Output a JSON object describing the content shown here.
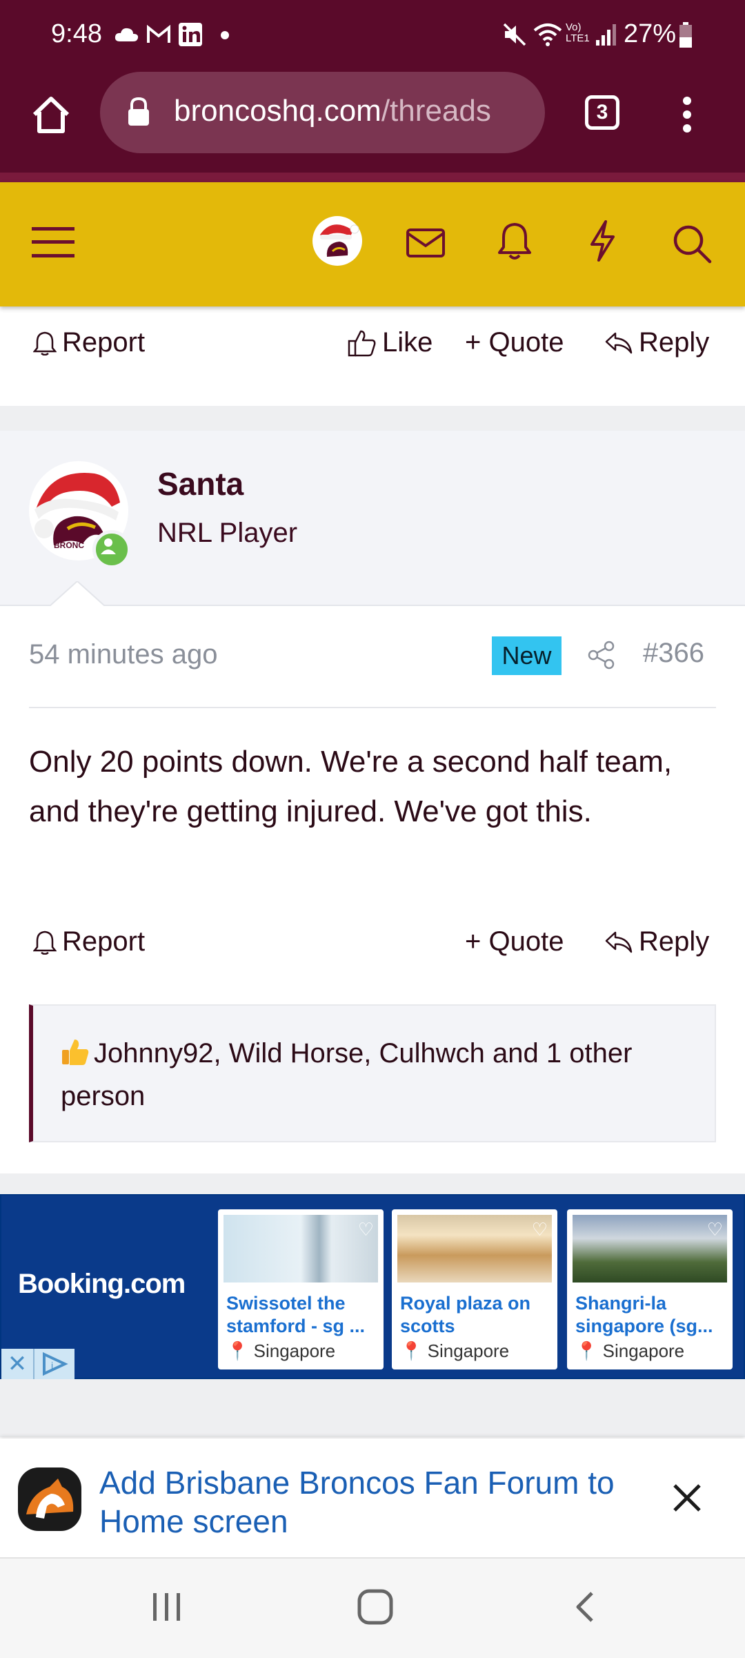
{
  "status_bar": {
    "time": "9:48",
    "icons": [
      "cloud-icon",
      "gmail-icon",
      "linkedin-icon",
      "dot-icon",
      "mute-icon",
      "wifi-icon",
      "volte-icon",
      "signal-icon",
      "battery-icon"
    ],
    "volte": "Vo) LTE1",
    "battery": "27%"
  },
  "browser": {
    "url_domain": "broncoshq.com",
    "url_path": "/threads",
    "tab_count": "3"
  },
  "top_actions": {
    "report": "Report",
    "like": "Like",
    "quote": "+ Quote",
    "reply": "Reply"
  },
  "post": {
    "author": "Santa",
    "role": "NRL Player",
    "time": "54 minutes ago",
    "badge": "New",
    "number": "#366",
    "body": "Only 20 points down. We're a second half team, and they're getting injured. We've got this.",
    "actions": {
      "report": "Report",
      "quote": "+ Quote",
      "reply": "Reply"
    },
    "reactions_text": "Johnny92, Wild Horse, Culhwch and 1 other person"
  },
  "ad": {
    "brand": "Booking.com",
    "cards": [
      {
        "title": "Swissotel the stamford - sg ...",
        "location": "Singapore"
      },
      {
        "title": "Royal plaza on scotts",
        "location": "Singapore"
      },
      {
        "title": "Shangri-la singapore (sg...",
        "location": "Singapore"
      }
    ]
  },
  "add_to_home": {
    "text": "Add Brisbane Broncos Fan Forum to Home screen"
  },
  "colors": {
    "maroon": "#5a0a2a",
    "gold": "#e3b90a",
    "badge_blue": "#33c4f0",
    "booking_blue": "#0a3a8a",
    "link_blue": "#1a5fb4"
  }
}
